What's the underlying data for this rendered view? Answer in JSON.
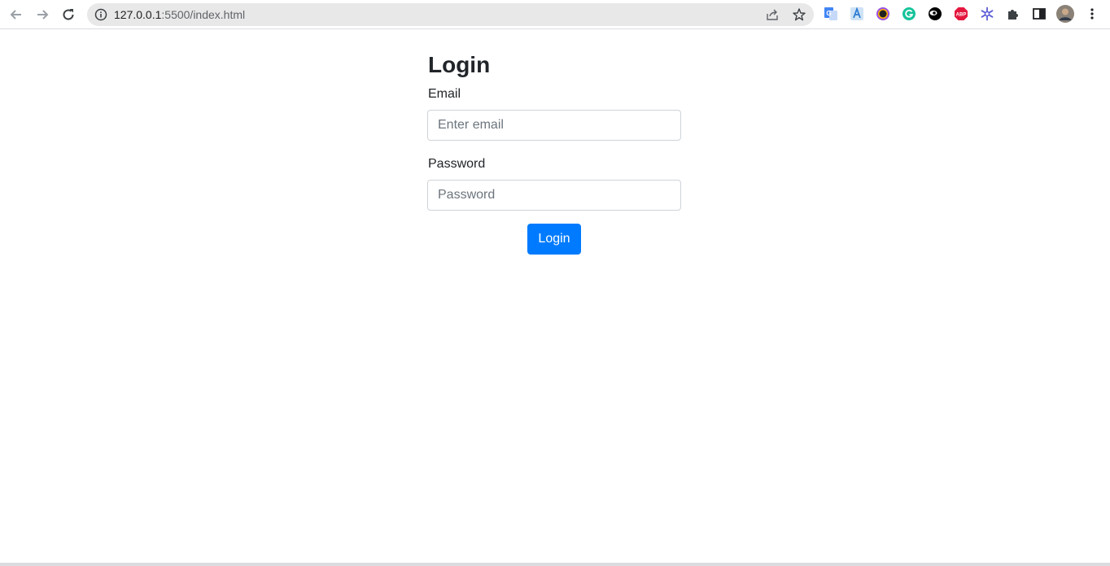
{
  "browser": {
    "url_host": "127.0.0.1",
    "url_rest": ":5500/index.html",
    "extensions": [
      {
        "name": "google-translate-extension-icon",
        "color": "#4285f4"
      },
      {
        "name": "text-tool-extension-icon",
        "color": "#2d7dd2"
      },
      {
        "name": "color-picker-extension-icon",
        "color": "#9b51e0"
      },
      {
        "name": "grammarly-extension-icon",
        "color": "#15c39a"
      },
      {
        "name": "eye-extension-icon",
        "color": "#000000"
      },
      {
        "name": "adblock-plus-extension-icon",
        "color": "#e4173e",
        "text": "ABP"
      },
      {
        "name": "snowflake-extension-icon",
        "color": "#5b5bd6"
      }
    ]
  },
  "login": {
    "title": "Login",
    "email_label": "Email",
    "email_placeholder": "Enter email",
    "password_label": "Password",
    "password_placeholder": "Password",
    "button_label": "Login"
  },
  "colors": {
    "primary": "#007bff",
    "text": "#212529",
    "input_border": "#ced4da"
  }
}
